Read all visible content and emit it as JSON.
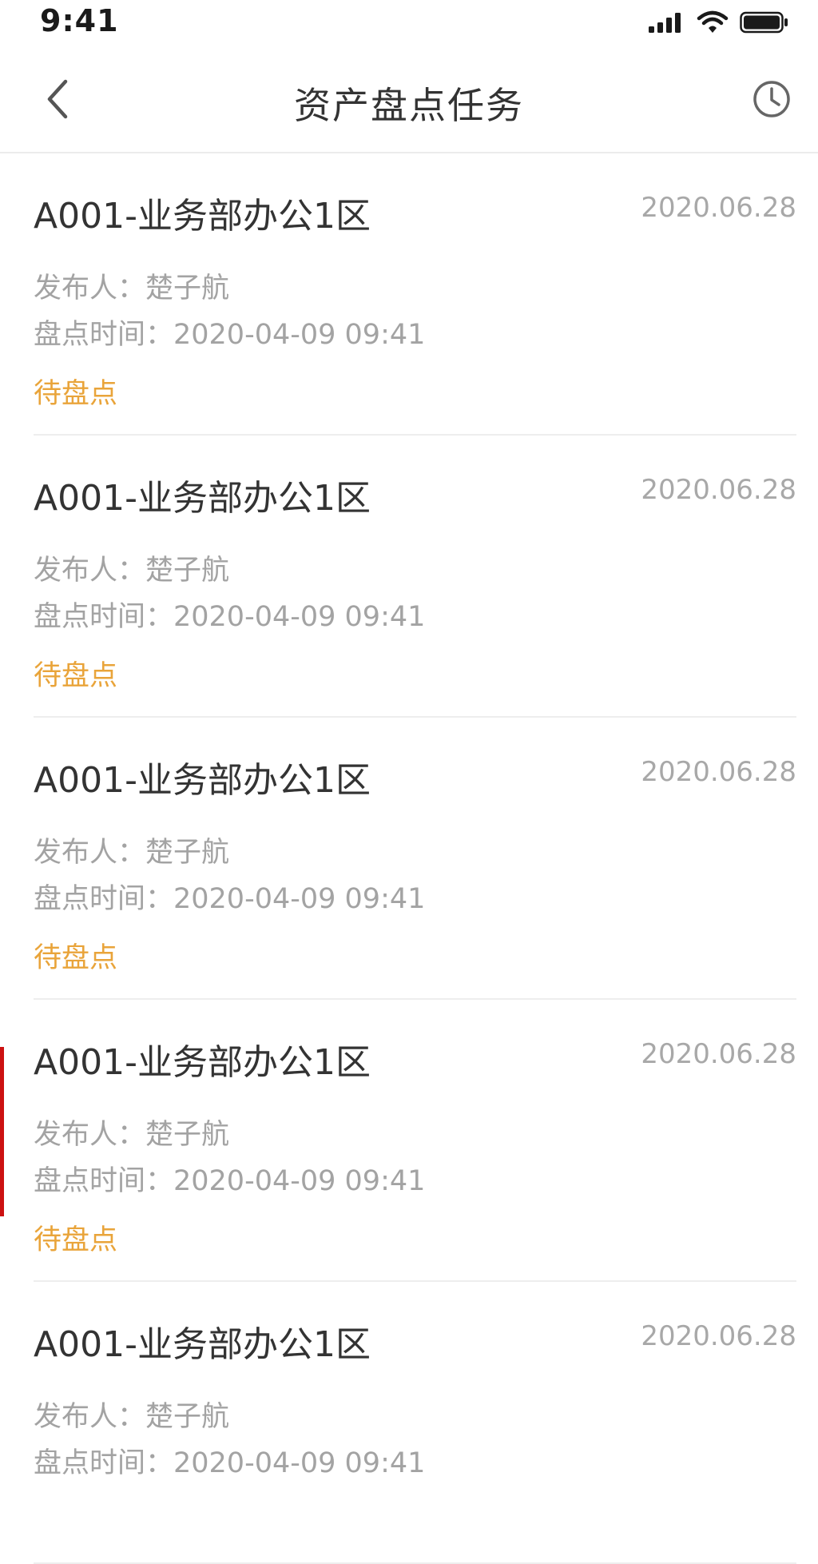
{
  "status_bar": {
    "time": "9:41",
    "icons": [
      "signal-icon",
      "wifi-icon",
      "battery-icon"
    ]
  },
  "nav": {
    "title": "资产盘点任务",
    "back_icon": "chevron-left-icon",
    "history_icon": "clock-icon"
  },
  "colors": {
    "status_pending": "#e9a43a",
    "text_primary": "#333333",
    "text_secondary": "#a3a3a3",
    "divider": "#eeeeee"
  },
  "tasks": [
    {
      "title": "A001-业务部办公1区",
      "date": "2020.06.28",
      "publisher": "发布人：楚子航",
      "time": "盘点时间：2020-04-09 09:41",
      "status": "待盘点"
    },
    {
      "title": "A001-业务部办公1区",
      "date": "2020.06.28",
      "publisher": "发布人：楚子航",
      "time": "盘点时间：2020-04-09 09:41",
      "status": "待盘点"
    },
    {
      "title": "A001-业务部办公1区",
      "date": "2020.06.28",
      "publisher": "发布人：楚子航",
      "time": "盘点时间：2020-04-09 09:41",
      "status": "待盘点"
    },
    {
      "title": "A001-业务部办公1区",
      "date": "2020.06.28",
      "publisher": "发布人：楚子航",
      "time": "盘点时间：2020-04-09 09:41",
      "status": "待盘点"
    },
    {
      "title": "A001-业务部办公1区",
      "date": "2020.06.28",
      "publisher": "发布人：楚子航",
      "time": "盘点时间：2020-04-09 09:41",
      "status": ""
    }
  ]
}
